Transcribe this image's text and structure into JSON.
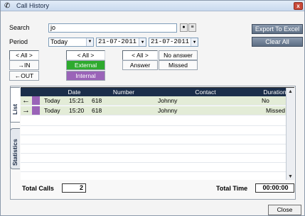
{
  "window": {
    "title": "Call History",
    "close_glyph": "x"
  },
  "filters": {
    "search_label": "Search",
    "search_value": "jo",
    "period_label": "Period",
    "period_value": "Today",
    "date_from": "21-07-2011",
    "date_to": "21-07-2011"
  },
  "buttons": {
    "export": "Export To Excel",
    "clear_all": "Clear All",
    "close": "Close"
  },
  "direction": {
    "all": "< All >",
    "in": "IN",
    "out": "OUT"
  },
  "location": {
    "all": "< All >",
    "external": "External",
    "internal": "Internal"
  },
  "answer": {
    "all": "< All >",
    "no_answer": "No answer",
    "answer": "Answer",
    "missed": "Missed"
  },
  "tabs": {
    "list": "List",
    "statistics": "Statistics"
  },
  "columns": {
    "date": "Date",
    "number": "Number",
    "contact": "Contact",
    "duration": "Duration"
  },
  "rows": [
    {
      "direction": "out",
      "day": "Today",
      "time": "15:21",
      "number": "618",
      "contact": "Johnny",
      "duration": "No answer"
    },
    {
      "direction": "in",
      "day": "Today",
      "time": "15:20",
      "number": "618",
      "contact": "Johnny",
      "duration": "Missed"
    }
  ],
  "totals": {
    "calls_label": "Total Calls",
    "calls_value": "2",
    "time_label": "Total Time",
    "time_value": "00:00:00"
  },
  "colors": {
    "external": "#2eaa2e",
    "internal": "#9a63b8",
    "header": "#1b2e4a",
    "row_highlight": "#e3ecd7"
  }
}
